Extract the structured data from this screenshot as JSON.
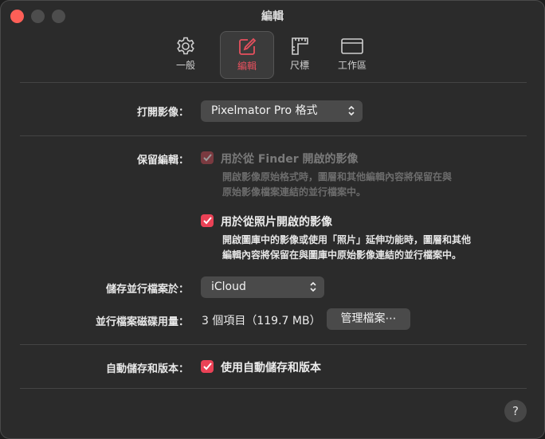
{
  "window": {
    "title": "編輯"
  },
  "tabs": [
    {
      "label": "一般",
      "icon": "gear-icon"
    },
    {
      "label": "編輯",
      "icon": "edit-square-icon",
      "active": true
    },
    {
      "label": "尺標",
      "icon": "ruler-icon"
    },
    {
      "label": "工作區",
      "icon": "window-icon"
    }
  ],
  "open_image": {
    "label": "打開影像：",
    "value": "Pixelmator Pro 格式"
  },
  "keep_edits": {
    "label": "保留編輯：",
    "finder": {
      "label": "用於從 Finder 開啟的影像",
      "checked": true,
      "enabled": false,
      "description_line1": "開啟影像原始格式時，圖層和其他編輯內容將保留在與",
      "description_line2": "原始影像檔案連結的並行檔案中。"
    },
    "photos": {
      "label": "用於從照片開啟的影像",
      "checked": true,
      "enabled": true,
      "description_line1": "開啟圖庫中的影像或使用「照片」延伸功能時，圖層和其他",
      "description_line2": "編輯內容將保留在與圖庫中原始影像連結的並行檔案中。"
    }
  },
  "sidecar_location": {
    "label": "儲存並行檔案於：",
    "value": "iCloud"
  },
  "sidecar_usage": {
    "label": "並行檔案磁碟用量：",
    "value": "3 個項目（119.7 MB）",
    "button": "管理檔案⋯"
  },
  "autosave": {
    "label": "自動儲存和版本：",
    "checkbox_label": "使用自動儲存和版本",
    "checked": true
  },
  "help": {
    "label": "?"
  },
  "colors": {
    "accent": "#ea4256",
    "window_bg": "#2b2b2b",
    "control_bg": "#4a4a4a"
  }
}
